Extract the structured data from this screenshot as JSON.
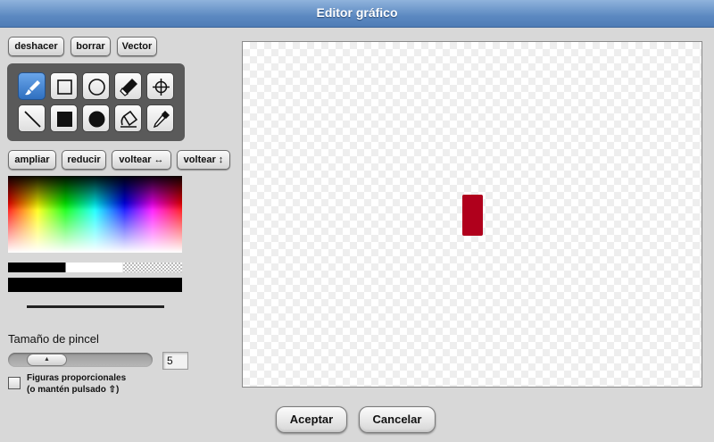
{
  "window": {
    "title": "Editor gráfico"
  },
  "top_buttons": {
    "undo": "deshacer",
    "clear": "borrar",
    "vector": "Vector"
  },
  "tools": [
    {
      "name": "paintbrush-icon",
      "selected": true
    },
    {
      "name": "rectangle-outline-icon",
      "selected": false
    },
    {
      "name": "ellipse-outline-icon",
      "selected": false
    },
    {
      "name": "eraser-icon",
      "selected": false
    },
    {
      "name": "crosshair-icon",
      "selected": false
    },
    {
      "name": "line-icon",
      "selected": false
    },
    {
      "name": "filled-rectangle-icon",
      "selected": false
    },
    {
      "name": "filled-ellipse-icon",
      "selected": false
    },
    {
      "name": "paint-bucket-icon",
      "selected": false
    },
    {
      "name": "eyedropper-icon",
      "selected": false
    }
  ],
  "transform_buttons": {
    "zoom_in": "ampliar",
    "zoom_out": "reducir",
    "flip_h": "voltear ↔",
    "flip_v": "voltear ↕"
  },
  "brush": {
    "label": "Tamaño de pincel",
    "size": "5"
  },
  "proportional": {
    "label_line1": "Figuras proporcionales",
    "label_line2": "(o mantén pulsado ⇧)",
    "checked": false
  },
  "colors": {
    "current": "#000000",
    "shape_fill": "#b0001c",
    "accent": "#5c89c1"
  },
  "footer": {
    "ok": "Aceptar",
    "cancel": "Cancelar"
  }
}
